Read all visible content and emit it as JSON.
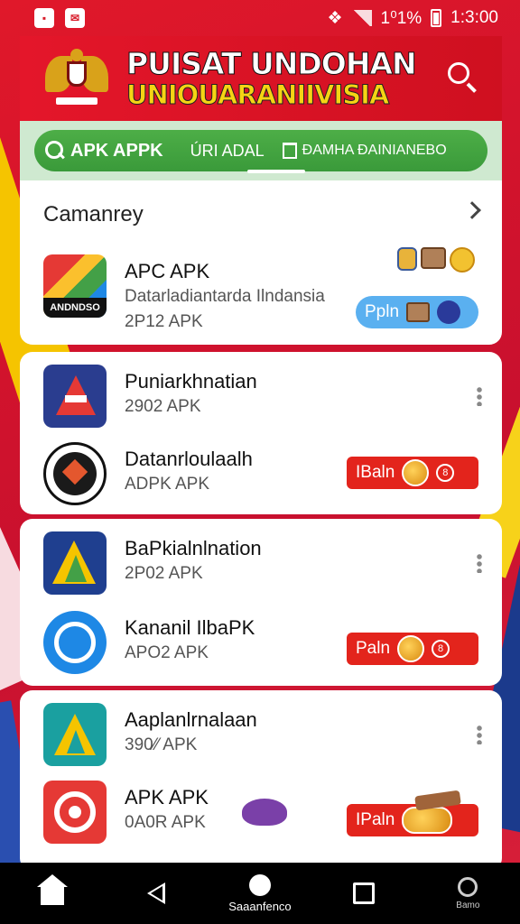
{
  "status_bar": {
    "battery": "1⁰1%",
    "time": "1:3:00"
  },
  "header": {
    "title_line1": "PUISAT UNDOHAN",
    "title_line2": "UNIOUARANIIVISIA"
  },
  "tabs": [
    {
      "label": "APK APPK",
      "icon": "search-icon"
    },
    {
      "label": "ÚRI ADAL",
      "icon": ""
    },
    {
      "label": "ĐAMHA ĐAINIANEBO",
      "icon": "trash-icon"
    }
  ],
  "section": {
    "title": "Camanrey"
  },
  "featured": {
    "name": "APC APK",
    "subtitle": "Datarladiantarda Ilndansia",
    "version": "2P12 APK",
    "icon_text": "ANDNDSO",
    "button_label": "Ppln"
  },
  "apps": [
    {
      "name": "Puniarkhnatian",
      "version": "2902 APK"
    },
    {
      "name": "Datanrloulaalh",
      "version": "ADPK APK",
      "button_label": "IBaln",
      "badge": "8"
    },
    {
      "name": "BaPkialnlnation",
      "version": "2P02 APK"
    },
    {
      "name": "Kananil IlbaPK",
      "version": "APO2 APK",
      "button_label": "Paln",
      "badge": "8"
    },
    {
      "name": "Aaplanlrnalaan",
      "version": "390⁄⁄ APK"
    },
    {
      "name": "APK APK",
      "version": "0A0R APK",
      "button_label": "IPaln"
    }
  ],
  "nav": {
    "center_label": "Saaanfenco",
    "right_label": "Bamo"
  },
  "colors": {
    "brand_red": "#e3241c",
    "tab_green": "#3fa03c",
    "button_blue": "#5ab0f0"
  }
}
